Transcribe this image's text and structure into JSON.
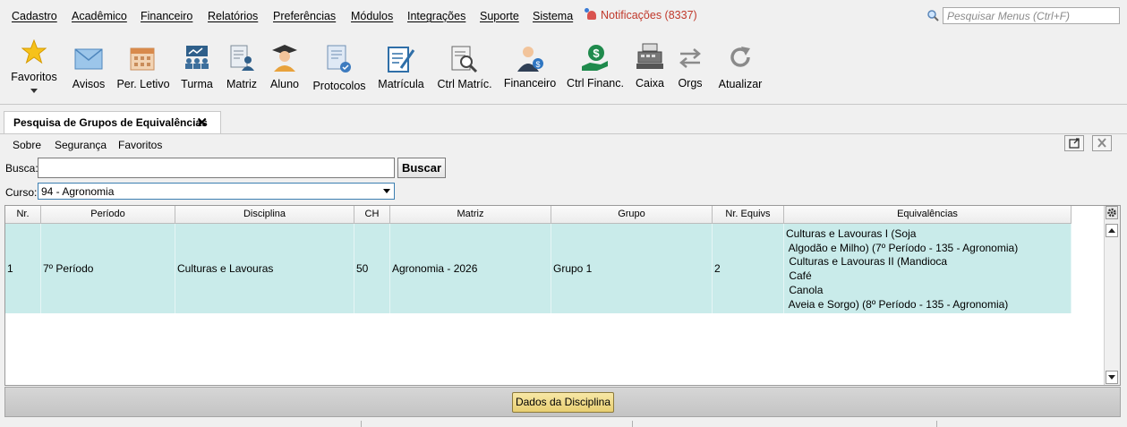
{
  "menu": {
    "items": [
      "Cadastro",
      "Acadêmico",
      "Financeiro",
      "Relatórios",
      "Preferências",
      "Módulos",
      "Integrações",
      "Suporte",
      "Sistema"
    ],
    "notifications": "Notificações (8337)",
    "search_placeholder": "Pesquisar Menus (Ctrl+F)"
  },
  "toolbar": {
    "items": [
      "Favoritos",
      "Avisos",
      "Per. Letivo",
      "Turma",
      "Matriz",
      "Aluno",
      "Protocolos",
      "Matrícula",
      "Ctrl Matríc.",
      "Financeiro",
      "Ctrl Financ.",
      "Caixa",
      "Orgs",
      "Atualizar"
    ]
  },
  "tab": {
    "title": "Pesquisa de Grupos de Equivalências",
    "close": "✕"
  },
  "submenu": {
    "items": [
      "Sobre",
      "Segurança",
      "Favoritos"
    ]
  },
  "form": {
    "busca_label": "Busca:",
    "busca_value": "",
    "buscar_button": "Buscar",
    "curso_label": "Curso:",
    "curso_value": "94 - Agronomia"
  },
  "table": {
    "headers": [
      "Nr.",
      "Período",
      "Disciplina",
      "CH",
      "Matriz",
      "Grupo",
      "Nr. Equivs",
      "Equivalências"
    ],
    "rows": [
      {
        "nr": "1",
        "periodo": "7º Período",
        "disciplina": "Culturas e Lavouras",
        "ch": "50",
        "matriz": "Agronomia - 2026",
        "grupo": "Grupo 1",
        "nr_equivs": "2",
        "equivalencias": "Culturas e Lavouras I (Soja\n Algodão e Milho) (7º Período - 135 - Agronomia)\n Culturas e Lavouras II (Mandioca\n Café\n Canola\n Aveia e Sorgo) (8º Período - 135 - Agronomia)"
      }
    ]
  },
  "footer": {
    "dados_button": "Dados da Disciplina"
  }
}
